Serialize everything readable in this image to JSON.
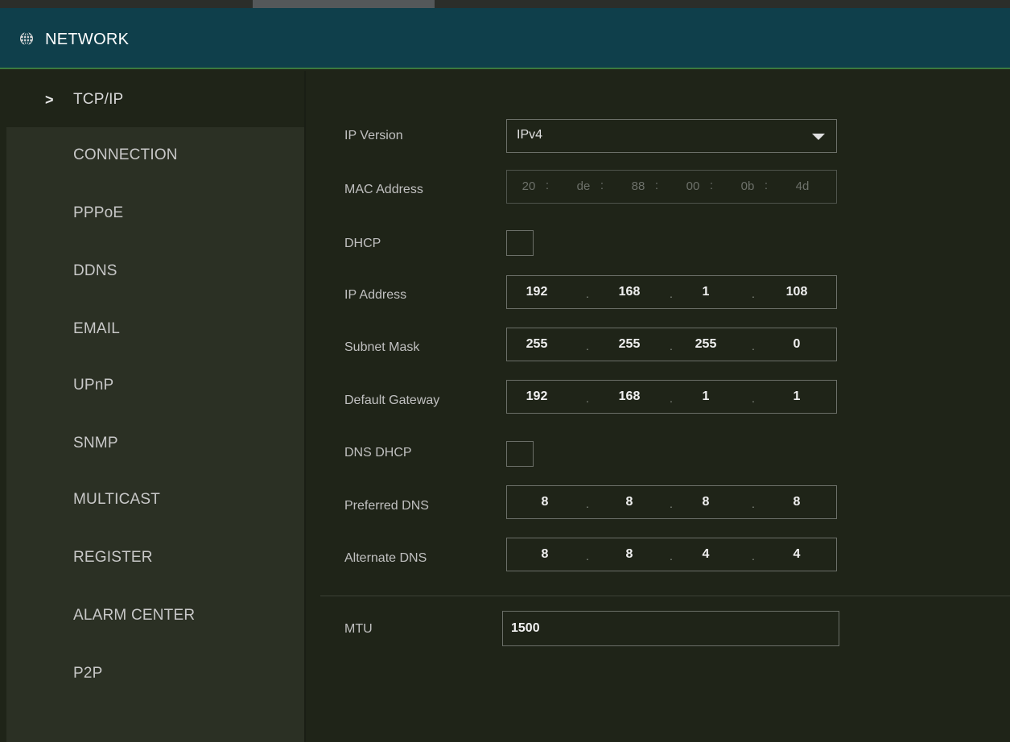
{
  "header": {
    "title": "NETWORK",
    "icon": "network-globe-icon"
  },
  "sidebar": {
    "active_marker": ">",
    "items": [
      {
        "label": "TCP/IP"
      },
      {
        "label": "CONNECTION"
      },
      {
        "label": "PPPoE"
      },
      {
        "label": "DDNS"
      },
      {
        "label": "EMAIL"
      },
      {
        "label": "UPnP"
      },
      {
        "label": "SNMP"
      },
      {
        "label": "MULTICAST"
      },
      {
        "label": "REGISTER"
      },
      {
        "label": "ALARM CENTER"
      },
      {
        "label": "P2P"
      }
    ]
  },
  "form": {
    "ip_version": {
      "label": "IP Version",
      "value": "IPv4"
    },
    "mac_address": {
      "label": "MAC Address",
      "segments": [
        "20",
        "de",
        "88",
        "00",
        "0b",
        "4d"
      ],
      "separator": ":"
    },
    "dhcp": {
      "label": "DHCP",
      "checked": false
    },
    "ip_address": {
      "label": "IP Address",
      "octets": [
        "192",
        "168",
        "1",
        "108"
      ]
    },
    "subnet_mask": {
      "label": "Subnet Mask",
      "octets": [
        "255",
        "255",
        "255",
        "0"
      ]
    },
    "default_gateway": {
      "label": "Default Gateway",
      "octets": [
        "192",
        "168",
        "1",
        "1"
      ]
    },
    "dns_dhcp": {
      "label": "DNS DHCP",
      "checked": false
    },
    "preferred_dns": {
      "label": "Preferred DNS",
      "octets": [
        "8",
        "8",
        "8",
        "8"
      ]
    },
    "alternate_dns": {
      "label": "Alternate DNS",
      "octets": [
        "8",
        "8",
        "4",
        "4"
      ]
    },
    "ip_separator": ".",
    "mtu": {
      "label": "MTU",
      "value": "1500"
    }
  },
  "colors": {
    "header_bg": "#0f3f4b",
    "header_border": "#3b7a3f",
    "sidebar_bg": "#2b3024",
    "content_bg": "#1f2418"
  }
}
